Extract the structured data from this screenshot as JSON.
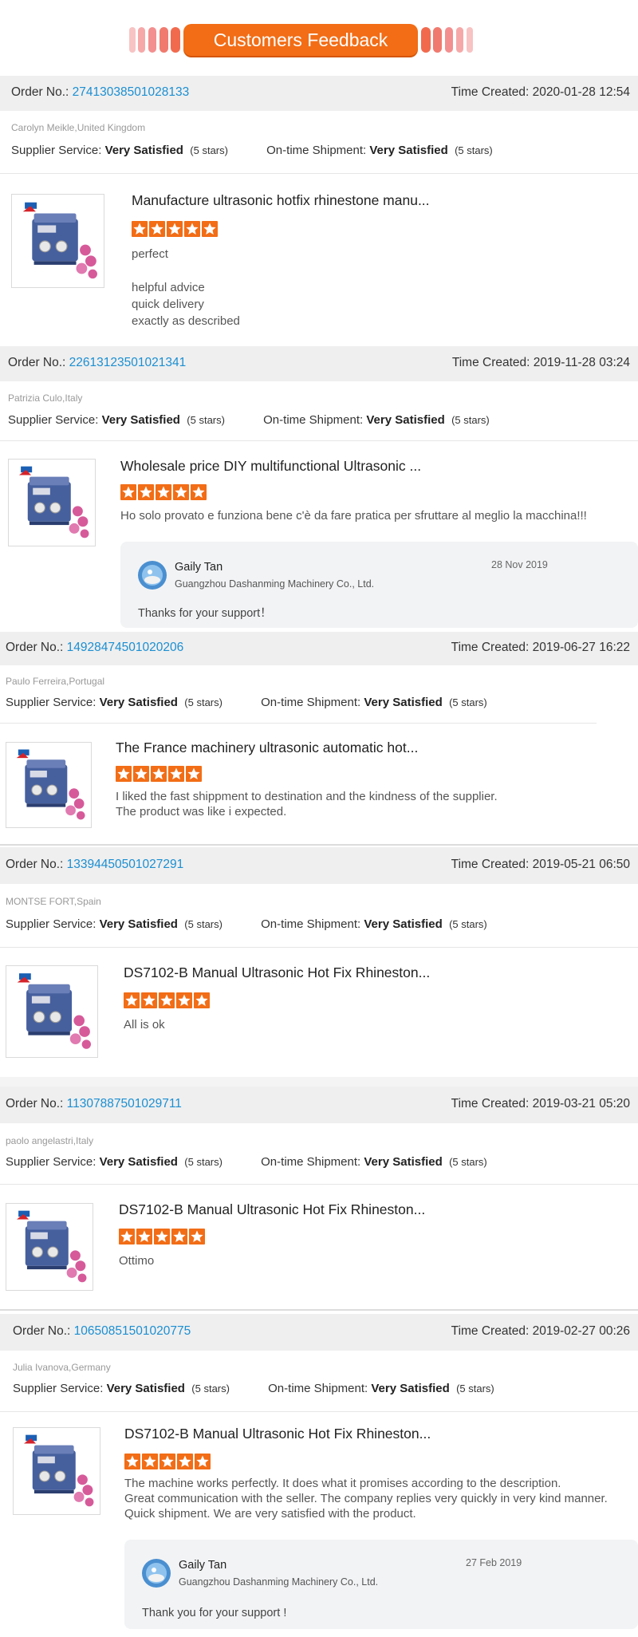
{
  "header": {
    "title": "Customers Feedback",
    "accent": "#f26d16"
  },
  "labels": {
    "order_no": "Order No.:",
    "time_created": "Time Created:",
    "supplier_service": "Supplier Service:",
    "ontime_shipment": "On-time Shipment:"
  },
  "reviews": [
    {
      "order_no": "27413038501028133",
      "time": "2020-01-28 12:54",
      "customer": "Carolyn Meikle,United Kingdom",
      "supplier_rating": "Very Satisfied",
      "supplier_stars": "(5 stars)",
      "shipment_rating": "Very Satisfied",
      "shipment_stars": "(5 stars)",
      "product_title": "Manufacture ultrasonic hotfix rhinestone manu...",
      "stars": 5,
      "comment_lines": [
        "perfect",
        "",
        "helpful advice",
        "quick delivery",
        "exactly as described"
      ]
    },
    {
      "order_no": "22613123501021341",
      "time": "2019-11-28 03:24",
      "customer": "Patrizia Culo,Italy",
      "supplier_rating": "Very Satisfied",
      "supplier_stars": "(5 stars)",
      "shipment_rating": "Very Satisfied",
      "shipment_stars": "(5 stars)",
      "product_title": "Wholesale price DIY multifunctional Ultrasonic ...",
      "stars": 5,
      "comment_lines": [
        "Ho solo provato e funziona bene c'è da fare pratica per sfruttare al meglio la macchina!!!"
      ],
      "reply": {
        "name": "Gaily Tan",
        "company": "Guangzhou Dashanming Machinery Co., Ltd.",
        "date": "28 Nov 2019",
        "text": "Thanks for your support！"
      }
    },
    {
      "order_no": "14928474501020206",
      "time": "2019-06-27 16:22",
      "customer": "Paulo Ferreira,Portugal",
      "supplier_rating": "Very Satisfied",
      "supplier_stars": "(5 stars)",
      "shipment_rating": "Very Satisfied",
      "shipment_stars": "(5 stars)",
      "product_title": "The France machinery ultrasonic automatic hot...",
      "stars": 5,
      "comment_lines": [
        "I liked the fast shippment to destination and the kindness of the supplier.",
        "The product was like i expected."
      ]
    },
    {
      "order_no": "13394450501027291",
      "time": "2019-05-21 06:50",
      "customer": "MONTSE FORT,Spain",
      "supplier_rating": "Very Satisfied",
      "supplier_stars": "(5 stars)",
      "shipment_rating": "Very Satisfied",
      "shipment_stars": "(5 stars)",
      "product_title": "DS7102-B Manual Ultrasonic Hot Fix Rhineston...",
      "stars": 5,
      "comment_lines": [
        "All is ok"
      ]
    },
    {
      "order_no": "11307887501029711",
      "time": "2019-03-21 05:20",
      "customer": "paolo angelastri,Italy",
      "supplier_rating": "Very Satisfied",
      "supplier_stars": "(5 stars)",
      "shipment_rating": "Very Satisfied",
      "shipment_stars": "(5 stars)",
      "product_title": "DS7102-B Manual Ultrasonic Hot Fix Rhineston...",
      "stars": 5,
      "comment_lines": [
        "Ottimo"
      ]
    },
    {
      "order_no": "10650851501020775",
      "time": "2019-02-27 00:26",
      "customer": "Julia Ivanova,Germany",
      "supplier_rating": "Very Satisfied",
      "supplier_stars": "(5 stars)",
      "shipment_rating": "Very Satisfied",
      "shipment_stars": "(5 stars)",
      "product_title": "DS7102-B Manual Ultrasonic Hot Fix Rhineston...",
      "stars": 5,
      "comment_lines": [
        "The machine works perfectly. It does what it promises according to the description.",
        "Great communication with the seller. The company replies very quickly in very kind manner.",
        "Quick shipment. We are very satisfied with the product."
      ],
      "reply": {
        "name": "Gaily Tan",
        "company": "Guangzhou Dashanming Machinery Co., Ltd.",
        "date": "27 Feb 2019",
        "text": "Thank you for your support !"
      }
    }
  ]
}
